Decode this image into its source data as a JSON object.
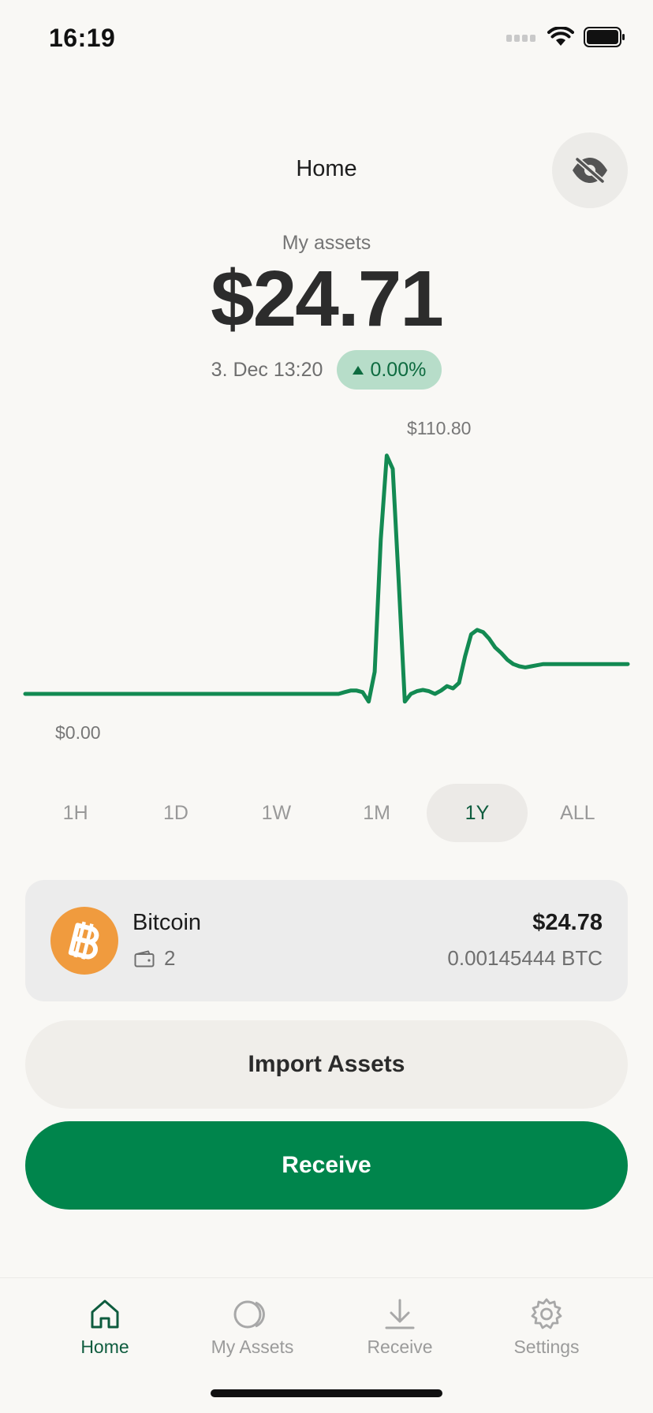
{
  "status_bar": {
    "time": "16:19"
  },
  "header": {
    "title": "Home",
    "hide_icon": "eye-slash-icon"
  },
  "summary": {
    "label": "My assets",
    "value": "$24.71",
    "date": "3. Dec 13:20",
    "change": "0.00%",
    "change_direction": "up"
  },
  "chart_data": {
    "type": "line",
    "max_label": "$110.80",
    "min_label": "$0.00",
    "ylim": [
      0,
      110.8
    ],
    "x": [
      0,
      5,
      10,
      15,
      20,
      25,
      30,
      35,
      40,
      45,
      50,
      52,
      53,
      54,
      55,
      56,
      57,
      58,
      59,
      60,
      61,
      62,
      63,
      64,
      65,
      66,
      67,
      68,
      69,
      70,
      71,
      72,
      73,
      74,
      75,
      76,
      77,
      78,
      79,
      80,
      81,
      82,
      83,
      84,
      85,
      86,
      87,
      88,
      89,
      90,
      91,
      92,
      93,
      94,
      95,
      96,
      97,
      98,
      99,
      100
    ],
    "y": [
      0,
      0,
      0,
      0,
      0,
      0,
      0,
      0,
      0,
      0,
      0,
      0,
      0.8,
      1.5,
      1.5,
      0.8,
      -3.5,
      10,
      70,
      108,
      102,
      50,
      -3.5,
      0,
      1.2,
      1.8,
      1.2,
      0,
      1.5,
      3.5,
      2.5,
      5,
      17,
      27,
      29,
      28,
      25,
      21,
      18.5,
      15.5,
      13.5,
      12.5,
      12,
      12.5,
      13,
      13.5,
      13.5,
      13.5,
      13.5,
      13.5,
      13.5,
      13.5,
      13.5,
      13.5,
      13.5,
      13.5,
      13.5,
      13.5,
      13.5,
      13.5
    ],
    "color": "#138a52"
  },
  "ranges": [
    {
      "label": "1H",
      "active": false
    },
    {
      "label": "1D",
      "active": false
    },
    {
      "label": "1W",
      "active": false
    },
    {
      "label": "1M",
      "active": false
    },
    {
      "label": "1Y",
      "active": true
    },
    {
      "label": "ALL",
      "active": false
    }
  ],
  "asset": {
    "name": "Bitcoin",
    "wallet_count": "2",
    "fiat_value": "$24.78",
    "crypto_value": "0.00145444 BTC",
    "logo_color": "#f09b3e"
  },
  "buttons": {
    "import": "Import Assets",
    "receive": "Receive"
  },
  "tabs": [
    {
      "label": "Home",
      "icon": "home-icon",
      "active": true
    },
    {
      "label": "My Assets",
      "icon": "coins-icon",
      "active": false
    },
    {
      "label": "Receive",
      "icon": "download-icon",
      "active": false
    },
    {
      "label": "Settings",
      "icon": "gear-icon",
      "active": false
    }
  ],
  "colors": {
    "accent": "#00854c",
    "badge_bg": "#b7ddc9",
    "badge_text": "#0e6b40"
  }
}
